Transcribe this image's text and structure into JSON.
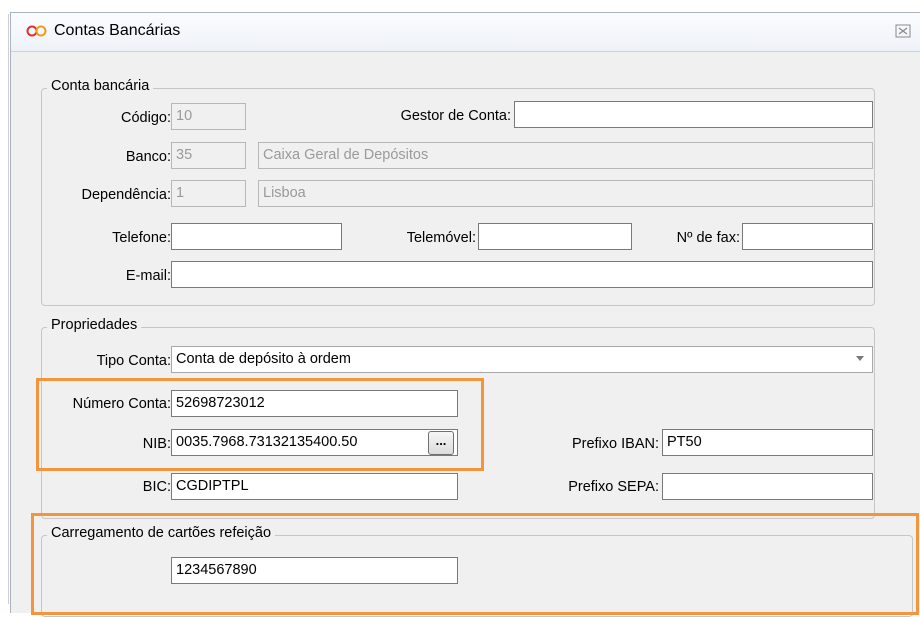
{
  "window": {
    "title": "Contas Bancárias"
  },
  "conta_bancaria": {
    "legend": "Conta bancária",
    "codigo": {
      "label": "Código:",
      "value": "10"
    },
    "gestor": {
      "label": "Gestor de Conta:",
      "value": ""
    },
    "banco": {
      "label": "Banco:",
      "code": "35",
      "name": "Caixa Geral de Depósitos"
    },
    "dependencia": {
      "label": "Dependência:",
      "code": "1",
      "name": "Lisboa"
    },
    "telefone": {
      "label": "Telefone:",
      "value": ""
    },
    "telemovel": {
      "label": "Telemóvel:",
      "value": ""
    },
    "fax": {
      "label": "Nº de fax:",
      "value": ""
    },
    "email": {
      "label": "E-mail:",
      "value": ""
    }
  },
  "propriedades": {
    "legend": "Propriedades",
    "tipo_conta": {
      "label": "Tipo Conta:",
      "value": "Conta de depósito à ordem"
    },
    "numero_conta": {
      "label": "Número Conta:",
      "value": "52698723012"
    },
    "nib": {
      "label": "NIB:",
      "value": "0035.7968.73132135400.50",
      "button": "..."
    },
    "prefixo_iban": {
      "label": "Prefixo IBAN:",
      "value": "PT50"
    },
    "bic": {
      "label": "BIC:",
      "value": "CGDIPTPL"
    },
    "prefixo_sepa": {
      "label": "Prefixo SEPA:",
      "value": ""
    }
  },
  "carregamento": {
    "legend": "Carregamento de cartões refeição",
    "value": "1234567890"
  },
  "colors": {
    "highlight": "#f2953d",
    "window_bg": "#f0f0f0"
  }
}
